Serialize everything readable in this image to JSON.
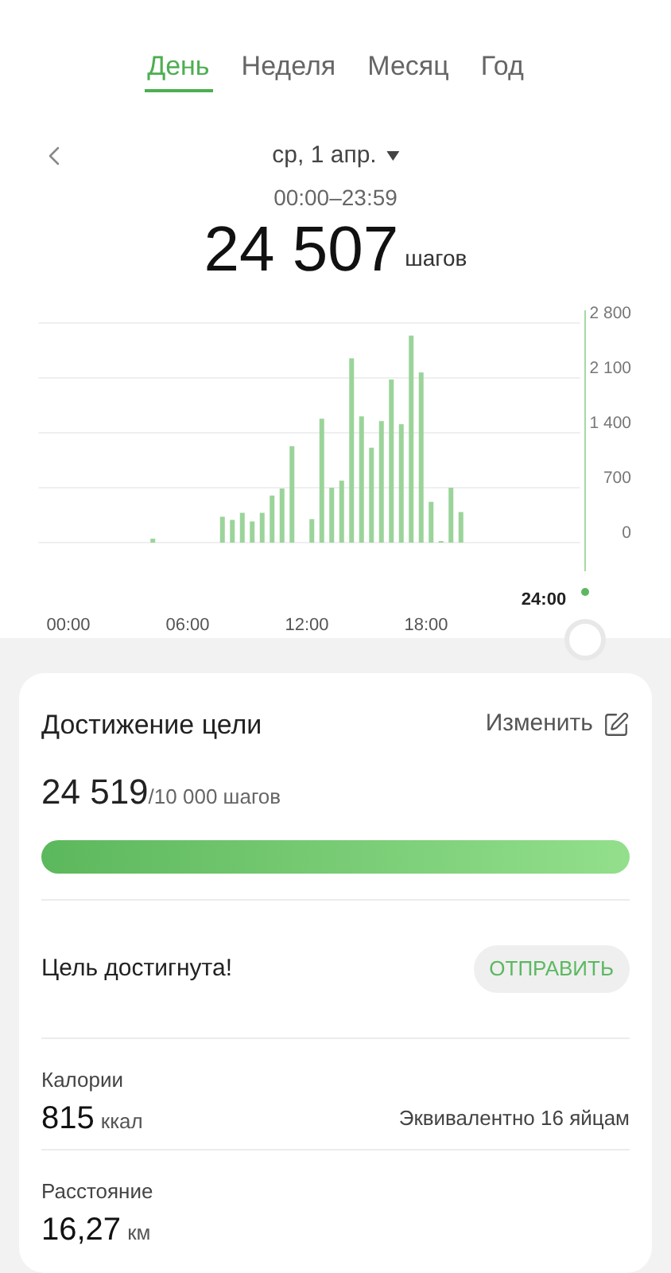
{
  "tabs": [
    {
      "label": "День",
      "selected": true
    },
    {
      "label": "Неделя",
      "selected": false
    },
    {
      "label": "Месяц",
      "selected": false
    },
    {
      "label": "Год",
      "selected": false
    }
  ],
  "date": "ср, 1 апр.",
  "time_range": "00:00–23:59",
  "total": {
    "value": "24 507",
    "unit": "шагов"
  },
  "chart": {
    "cursor_label": "24:00",
    "chart_data": {
      "type": "bar",
      "x": [
        4.25,
        7.75,
        8.25,
        8.75,
        9.25,
        9.75,
        10.25,
        10.75,
        11.25,
        12.25,
        12.75,
        13.25,
        13.75,
        14.25,
        14.75,
        15.25,
        15.75,
        16.25,
        16.75,
        17.25,
        17.75,
        18.25,
        18.75,
        19.25,
        19.75
      ],
      "values": [
        50,
        330,
        290,
        380,
        270,
        380,
        600,
        690,
        1230,
        300,
        1580,
        700,
        790,
        2350,
        1610,
        1210,
        1550,
        2080,
        1510,
        2640,
        2170,
        520,
        20,
        700,
        390
      ],
      "xlim": [
        -1.5,
        25.75
      ],
      "ylim": [
        0,
        2800
      ],
      "grid": true,
      "xticks": [
        {
          "value": 0,
          "label": "00:00"
        },
        {
          "value": 6,
          "label": "06:00"
        },
        {
          "value": 12,
          "label": "12:00"
        },
        {
          "value": 18,
          "label": "18:00"
        }
      ],
      "yticks": [
        {
          "value": 0,
          "label": "0"
        },
        {
          "value": 700,
          "label": "700"
        },
        {
          "value": 1400,
          "label": "1 400"
        },
        {
          "value": 2100,
          "label": "2 100"
        },
        {
          "value": 2800,
          "label": "2 800"
        }
      ]
    }
  },
  "goal": {
    "title": "Достижение цели",
    "edit": "Изменить",
    "steps": "24 519",
    "target": "/10 000 шагов",
    "status": "Цель достигнута!",
    "share": "ОТПРАВИТЬ"
  },
  "stats": [
    {
      "label": "Калории",
      "value": "815",
      "unit": "ккал",
      "note": "Эквивалентно 16 яйцам"
    },
    {
      "label": "Расстояние",
      "value": "16,27",
      "unit": "км"
    }
  ]
}
